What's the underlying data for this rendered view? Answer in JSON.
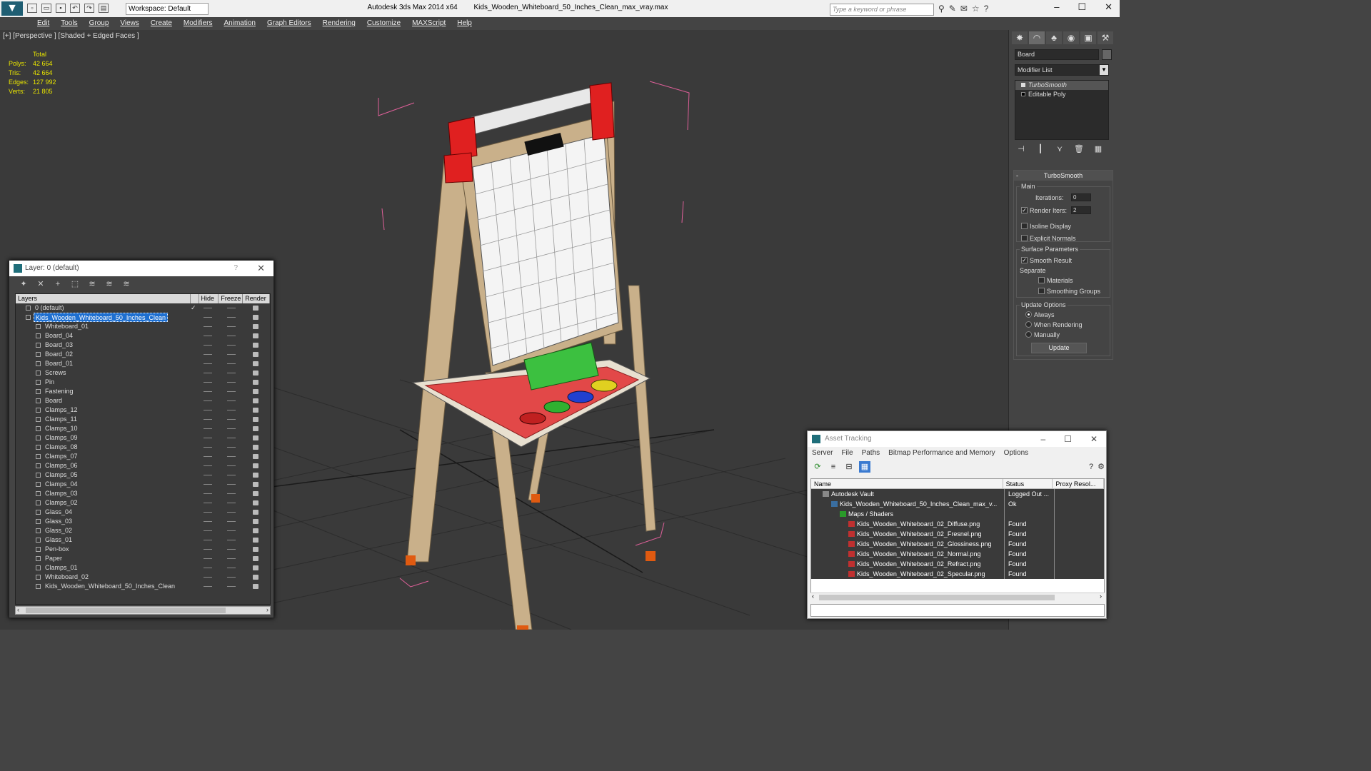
{
  "titlebar": {
    "app": "Autodesk 3ds Max  2014 x64",
    "file": "Kids_Wooden_Whiteboard_50_Inches_Clean_max_vray.max",
    "workspace": "Workspace: Default",
    "search_placeholder": "Type a keyword or phrase"
  },
  "menu": [
    "Edit",
    "Tools",
    "Group",
    "Views",
    "Create",
    "Modifiers",
    "Animation",
    "Graph Editors",
    "Rendering",
    "Customize",
    "MAXScript",
    "Help"
  ],
  "viewport": {
    "label": "[+] [Perspective ] [Shaded + Edged Faces ]",
    "stats_header": "Total",
    "stats": [
      {
        "k": "Polys:",
        "v": "42 664"
      },
      {
        "k": "Tris:",
        "v": "42 664"
      },
      {
        "k": "Edges:",
        "v": "127 992"
      },
      {
        "k": "Verts:",
        "v": "21 805"
      }
    ]
  },
  "command_panel": {
    "object_name": "Board",
    "modifier_list": "Modifier List",
    "stack": [
      "TurboSmooth",
      "Editable Poly"
    ],
    "rollout_title": "TurboSmooth",
    "main_label": "Main",
    "iterations_label": "Iterations:",
    "iterations_value": "0",
    "render_iters_label": "Render Iters:",
    "render_iters_value": "2",
    "isoline": "Isoline Display",
    "explicit_normals": "Explicit Normals",
    "surface_params": "Surface Parameters",
    "smooth_result": "Smooth Result",
    "separate": "Separate",
    "materials": "Materials",
    "smoothing_groups": "Smoothing Groups",
    "update_options": "Update Options",
    "always": "Always",
    "when_rendering": "When Rendering",
    "manually": "Manually",
    "update_btn": "Update"
  },
  "layer_window": {
    "title": "Layer: 0 (default)",
    "help": "?",
    "columns": [
      "Layers",
      "Hide",
      "Freeze",
      "Render"
    ],
    "rows": [
      {
        "name": "0 (default)",
        "level": 1,
        "check": true
      },
      {
        "name": "Kids_Wooden_Whiteboard_50_Inches_Clean",
        "level": 1,
        "selected": true
      },
      {
        "name": "Whiteboard_01",
        "level": 2
      },
      {
        "name": "Board_04",
        "level": 2
      },
      {
        "name": "Board_03",
        "level": 2
      },
      {
        "name": "Board_02",
        "level": 2
      },
      {
        "name": "Board_01",
        "level": 2
      },
      {
        "name": "Screws",
        "level": 2
      },
      {
        "name": "Pin",
        "level": 2
      },
      {
        "name": "Fastening",
        "level": 2
      },
      {
        "name": "Board",
        "level": 2
      },
      {
        "name": "Clamps_12",
        "level": 2
      },
      {
        "name": "Clamps_11",
        "level": 2
      },
      {
        "name": "Clamps_10",
        "level": 2
      },
      {
        "name": "Clamps_09",
        "level": 2
      },
      {
        "name": "Clamps_08",
        "level": 2
      },
      {
        "name": "Clamps_07",
        "level": 2
      },
      {
        "name": "Clamps_06",
        "level": 2
      },
      {
        "name": "Clamps_05",
        "level": 2
      },
      {
        "name": "Clamps_04",
        "level": 2
      },
      {
        "name": "Clamps_03",
        "level": 2
      },
      {
        "name": "Clamps_02",
        "level": 2
      },
      {
        "name": "Glass_04",
        "level": 2
      },
      {
        "name": "Glass_03",
        "level": 2
      },
      {
        "name": "Glass_02",
        "level": 2
      },
      {
        "name": "Glass_01",
        "level": 2
      },
      {
        "name": "Pen-box",
        "level": 2
      },
      {
        "name": "Paper",
        "level": 2
      },
      {
        "name": "Clamps_01",
        "level": 2
      },
      {
        "name": "Whiteboard_02",
        "level": 2
      },
      {
        "name": "Kids_Wooden_Whiteboard_50_Inches_Clean",
        "level": 2
      }
    ]
  },
  "asset_window": {
    "title": "Asset Tracking",
    "menu": [
      "Server",
      "File",
      "Paths",
      "Bitmap Performance and Memory",
      "Options"
    ],
    "columns": [
      "Name",
      "Status",
      "Proxy Resol..."
    ],
    "rows": [
      {
        "name": "Autodesk Vault",
        "status": "Logged Out ...",
        "level": 0,
        "icon": "vault"
      },
      {
        "name": "Kids_Wooden_Whiteboard_50_Inches_Clean_max_v...",
        "status": "Ok",
        "level": 1,
        "icon": "max"
      },
      {
        "name": "Maps / Shaders",
        "status": "",
        "level": 2,
        "icon": "folder"
      },
      {
        "name": "Kids_Wooden_Whiteboard_02_Diffuse.png",
        "status": "Found",
        "level": 3,
        "icon": "png"
      },
      {
        "name": "Kids_Wooden_Whiteboard_02_Fresnel.png",
        "status": "Found",
        "level": 3,
        "icon": "png"
      },
      {
        "name": "Kids_Wooden_Whiteboard_02_Glossiness.png",
        "status": "Found",
        "level": 3,
        "icon": "png"
      },
      {
        "name": "Kids_Wooden_Whiteboard_02_Normal.png",
        "status": "Found",
        "level": 3,
        "icon": "png"
      },
      {
        "name": "Kids_Wooden_Whiteboard_02_Refract.png",
        "status": "Found",
        "level": 3,
        "icon": "png"
      },
      {
        "name": "Kids_Wooden_Whiteboard_02_Specular.png",
        "status": "Found",
        "level": 3,
        "icon": "png"
      }
    ]
  }
}
